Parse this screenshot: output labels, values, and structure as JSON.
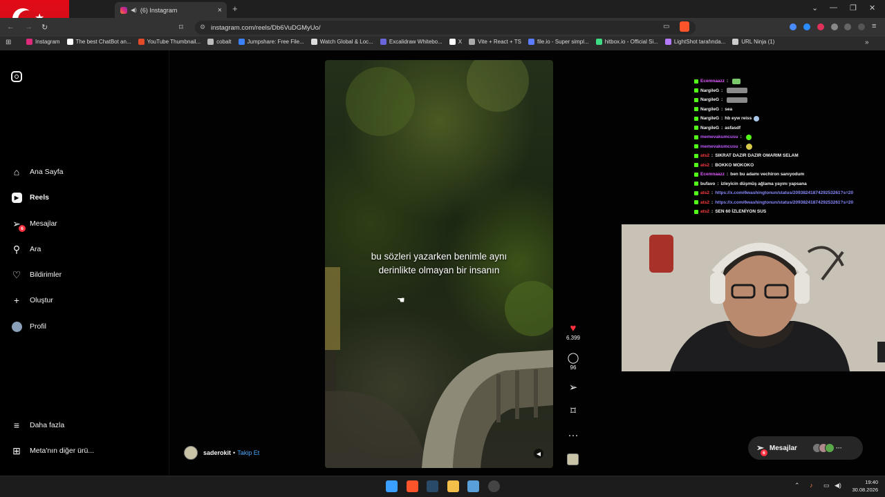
{
  "browser": {
    "tab_title": "(6) Instagram",
    "url": "instagram.com/reels/Db6VuDGMyUo/",
    "new_tab": "+",
    "tab_close": "×",
    "bookmarks": [
      {
        "label": "Instagram",
        "color": "#dd2a7b"
      },
      {
        "label": "The best ChatBot an...",
        "color": "#ffffff"
      },
      {
        "label": "YouTube Thumbnail...",
        "color": "#e24a2a"
      },
      {
        "label": "cobalt",
        "color": "#bbbbbb"
      },
      {
        "label": "Jumpshare: Free File...",
        "color": "#3b82f6"
      },
      {
        "label": "Watch Global & Loc...",
        "color": "#dddddd"
      },
      {
        "label": "Excalidraw Whitebo...",
        "color": "#6965db"
      },
      {
        "label": "X",
        "color": "#ffffff"
      },
      {
        "label": "Vite + React + TS",
        "color": "#aaaaaa"
      },
      {
        "label": "file.io - Super simpl...",
        "color": "#5b7cff"
      },
      {
        "label": "hitbox.io - Official Si...",
        "color": "#3ddc84"
      },
      {
        "label": "LightShot tarafında...",
        "color": "#b57bff"
      },
      {
        "label": "URL Ninja (1)",
        "color": "#cccccc"
      }
    ]
  },
  "sidebar": {
    "items": [
      {
        "label": "Ana Sayfa",
        "icon": "home-icon"
      },
      {
        "label": "Reels",
        "icon": "reels-icon"
      },
      {
        "label": "Mesajlar",
        "icon": "messages-icon",
        "badge": "6"
      },
      {
        "label": "Ara",
        "icon": "search-icon"
      },
      {
        "label": "Bildirimler",
        "icon": "heart-icon"
      },
      {
        "label": "Oluştur",
        "icon": "plus-icon"
      },
      {
        "label": "Profil",
        "icon": "profile-avatar"
      },
      {
        "label": "Daha fazla",
        "icon": "menu-icon"
      },
      {
        "label": "Meta'nın diğer ürü...",
        "icon": "meta-apps-icon"
      }
    ]
  },
  "reel": {
    "caption_line1": "bu sözleri yazarken benimle aynı",
    "caption_line2": "derinlikte olmayan bir insanın",
    "author": "saderokit",
    "follow": "Takip Et",
    "separator": "•",
    "likes": "6.399",
    "comments": "96"
  },
  "chat": [
    {
      "user": "Ecemnaazz",
      "color": "#e45aff",
      "msg": ""
    },
    {
      "user": "NargileG",
      "color": "#ffffff",
      "msg": ""
    },
    {
      "user": "NargileG",
      "color": "#ffffff",
      "msg": ""
    },
    {
      "user": "NargileG",
      "color": "#ffffff",
      "msg": "sea"
    },
    {
      "user": "NargileG",
      "color": "#ffffff",
      "msg": "hb eyw reiss"
    },
    {
      "user": "NargileG",
      "color": "#ffffff",
      "msg": "asfasdf"
    },
    {
      "user": "memevakumcusu",
      "color": "#c05cff",
      "msg": ""
    },
    {
      "user": "memevakumcusu",
      "color": "#c05cff",
      "msg": ""
    },
    {
      "user": "ats2",
      "color": "#ff3b3b",
      "msg": "SIKRAT DAZIR DAZIR OMARIM SELAM"
    },
    {
      "user": "ats2",
      "color": "#ff3b3b",
      "msg": "BOKKO MOKOKO"
    },
    {
      "user": "Ecemnaazz",
      "color": "#e45aff",
      "msg": "ben bu adamı vechiron sanıyodum"
    },
    {
      "user": "bufavo",
      "color": "#ffffff",
      "msg": "izleyicin düşmüş ağlama yayını yapsana"
    },
    {
      "user": "ats2",
      "color": "#ff3b3b",
      "msg": "https://x.com/6washingtonun/status/2093824187429253261?s=20",
      "link": true
    },
    {
      "user": "ats2",
      "color": "#ff3b3b",
      "msg": "https://x.com/6washingtonun/status/2093824187429253261?s=20",
      "link": true
    },
    {
      "user": "ats2",
      "color": "#ff3b3b",
      "msg": "SEN 60 İZLENİYON SUS"
    }
  ],
  "messages_pill": {
    "label": "Mesajlar",
    "badge": "6"
  },
  "taskbar": {
    "time": "19:40",
    "date": "30.08.2026"
  }
}
